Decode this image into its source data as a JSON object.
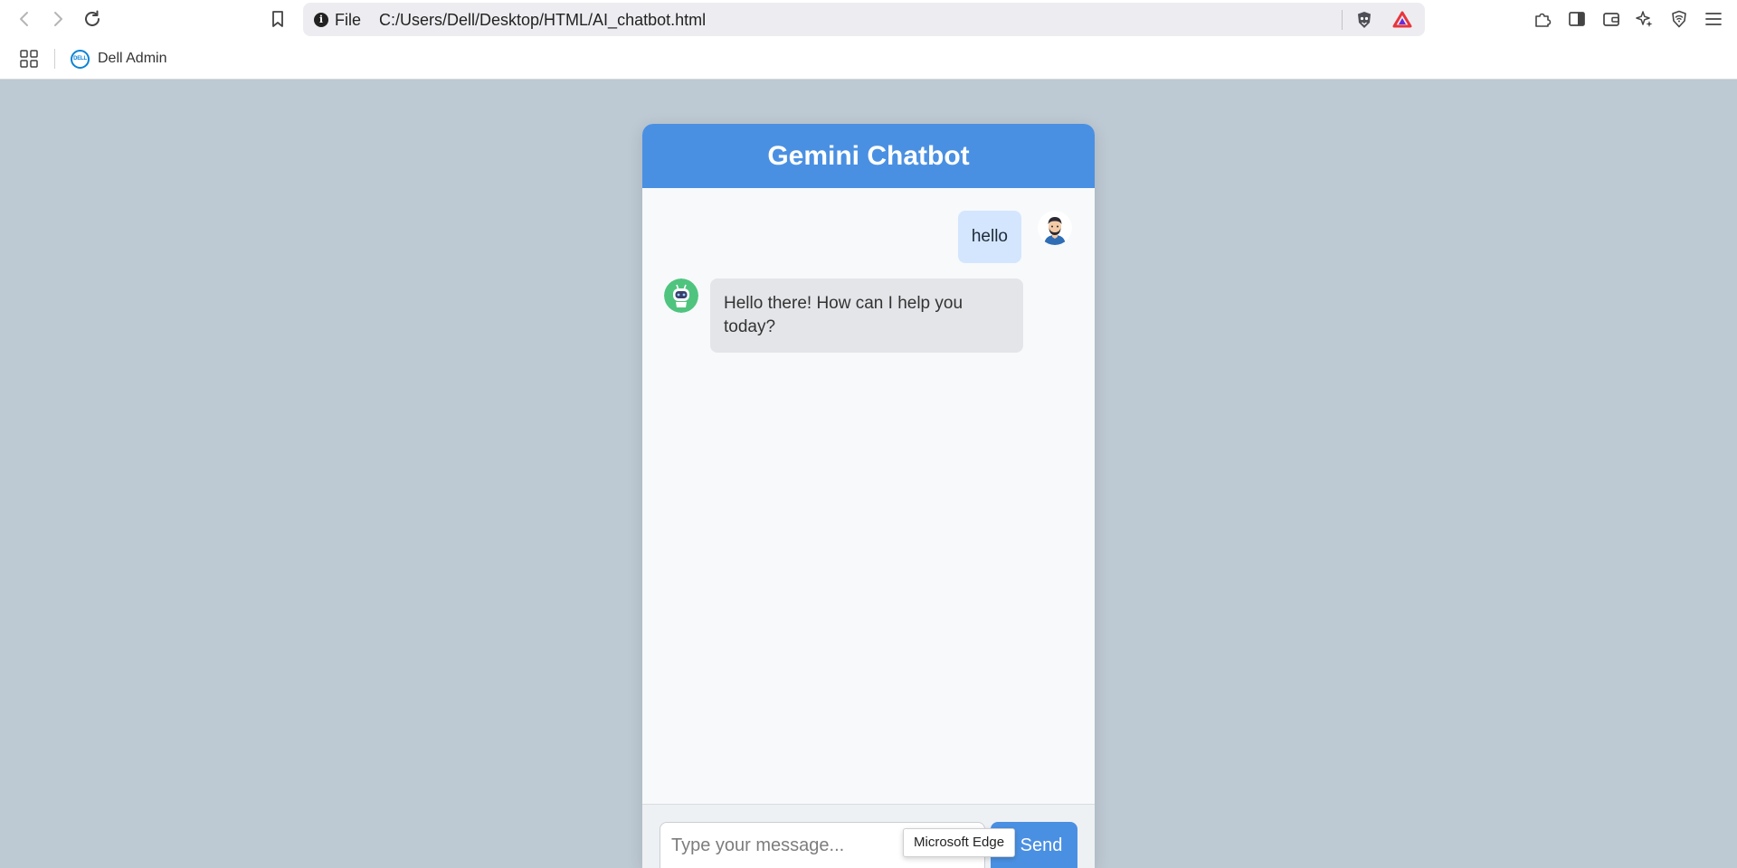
{
  "browser": {
    "address_scheme": "File",
    "url": "C:/Users/Dell/Desktop/HTML/AI_chatbot.html",
    "icons": [
      "back-icon",
      "forward-icon",
      "reload-icon",
      "bookmark-icon",
      "info-icon",
      "brave-shield-icon",
      "brave-rewards-icon",
      "extensions-icon",
      "sidebar-icon",
      "wallet-icon",
      "leo-ai-icon",
      "vpn-icon",
      "menu-icon"
    ],
    "bookmarks": [
      {
        "label": "Dell Admin",
        "icon": "dell-logo-icon"
      }
    ]
  },
  "chat": {
    "title": "Gemini Chatbot",
    "messages": [
      {
        "sender": "user",
        "text": "hello"
      },
      {
        "sender": "bot",
        "text": "Hello there! How can I help you today?"
      }
    ],
    "input_placeholder": "Type your message...",
    "send_label": "Send"
  },
  "tooltip": {
    "text": "Microsoft Edge"
  },
  "colors": {
    "page_background": "#bdc9d3",
    "header": "#4a90e2",
    "user_bubble": "#d4e6fd",
    "bot_bubble": "#e3e5e8",
    "send_button": "#4a90e2"
  }
}
